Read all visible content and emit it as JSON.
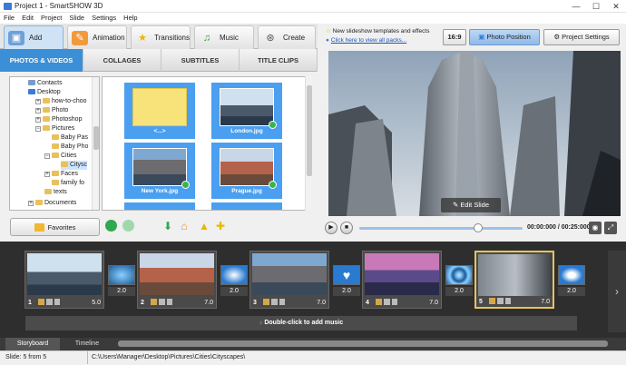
{
  "window": {
    "title": "Project 1 - SmartSHOW 3D",
    "min": "—",
    "max": "☐",
    "close": "✕"
  },
  "menu": [
    "File",
    "Edit",
    "Project",
    "Slide",
    "Settings",
    "Help"
  ],
  "top_tabs": [
    {
      "label": "Add",
      "icon": "add-icon"
    },
    {
      "label": "Animation",
      "icon": "palette-icon"
    },
    {
      "label": "Transitions",
      "icon": "star-icon"
    },
    {
      "label": "Music",
      "icon": "music-icon"
    },
    {
      "label": "Create",
      "icon": "film-reel-icon"
    }
  ],
  "sub_tabs": [
    "PHOTOS & VIDEOS",
    "COLLAGES",
    "SUBTITLES",
    "TITLE CLIPS"
  ],
  "tree": [
    "Contacts",
    "Desktop",
    "how-to-choo",
    "Photo",
    "Photoshop",
    "Pictures",
    "Baby Pas",
    "Baby Pho",
    "Cities",
    "Citysc",
    "Faces",
    "family fo",
    "texts",
    "Documents"
  ],
  "files": [
    {
      "name": "<...>"
    },
    {
      "name": "London.jpg"
    },
    {
      "name": "New York.jpg"
    },
    {
      "name": "Prague.jpg"
    }
  ],
  "favorites_label": "Favorites",
  "notice": {
    "line1": "New slideshow templates and effects",
    "line2": "Click here to view all packs..."
  },
  "aspect_ratio": "16:9",
  "photo_position_label": "Photo Position",
  "project_settings_label": "Project Settings",
  "edit_slide_label": "Edit Slide",
  "timecode": "00:00:000 / 00:25:000",
  "playback_progress": 0.73,
  "slides": [
    {
      "num": "1",
      "duration": "5.0",
      "transition": "2.0"
    },
    {
      "num": "2",
      "duration": "7.0",
      "transition": "2.0"
    },
    {
      "num": "3",
      "duration": "7.0",
      "transition": "2.0"
    },
    {
      "num": "4",
      "duration": "7.0",
      "transition": "2.0"
    },
    {
      "num": "5",
      "duration": "7.0",
      "transition": "2.0"
    }
  ],
  "music_hint": "Double-click to add music",
  "bottom_tabs": [
    "Storyboard",
    "Timeline"
  ],
  "status": {
    "slide": "Slide: 5 from 5",
    "path": "C:\\Users\\Manager\\Desktop\\Pictures\\Cities\\Cityscapes\\"
  }
}
